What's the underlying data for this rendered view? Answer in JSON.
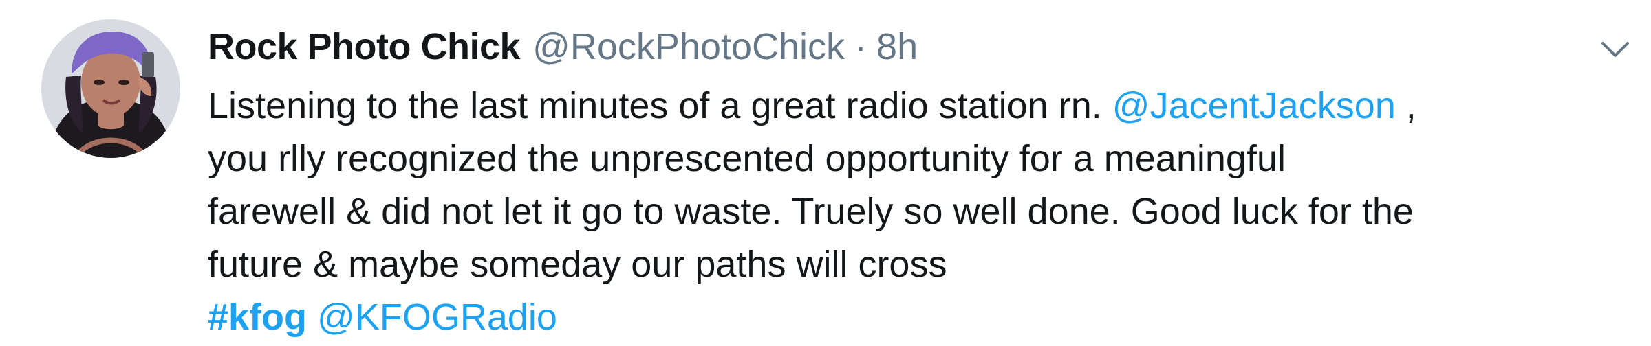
{
  "tweet": {
    "author_name": "Rock Photo Chick",
    "author_handle": "@RockPhotoChick",
    "separator": "·",
    "time": "8h",
    "text": {
      "line1_before": "Listening to the last minutes of a great radio station rn.",
      "line1_mention": "@JacentJackson",
      "line1_after": ",",
      "line2": "you rlly recognized the unprescented opportunity for a meaningful",
      "line3": "farewell & did not let it go to waste. Truely so well done. Good luck for the",
      "line4": "future & maybe someday our paths will cross"
    },
    "hashtag": "#kfog",
    "mention2": "@KFOGRadio",
    "more_icon": "chevron-down-icon"
  },
  "colors": {
    "link": "#1da1f2",
    "secondary_text": "#657786",
    "primary_text": "#14171a"
  }
}
